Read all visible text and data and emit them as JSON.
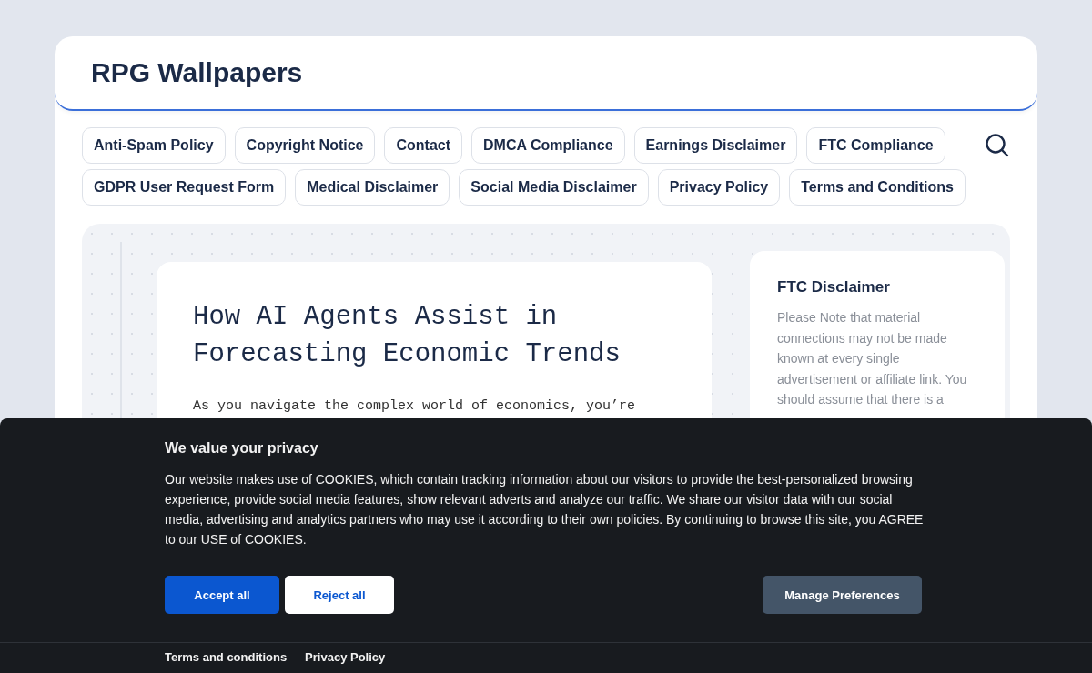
{
  "site": {
    "title": "RPG Wallpapers"
  },
  "nav": {
    "items": [
      {
        "label": "Anti-Spam Policy"
      },
      {
        "label": "Copyright Notice"
      },
      {
        "label": "Contact"
      },
      {
        "label": "DMCA Compliance"
      },
      {
        "label": "Earnings Disclaimer"
      },
      {
        "label": "FTC Compliance"
      },
      {
        "label": "GDPR User Request Form"
      },
      {
        "label": "Medical Disclaimer"
      },
      {
        "label": "Social Media Disclaimer"
      },
      {
        "label": "Privacy Policy"
      },
      {
        "label": "Terms and Conditions"
      }
    ]
  },
  "article": {
    "title": "How AI Agents Assist in Forecasting Economic Trends",
    "excerpt": "As you navigate the complex world of economics, you’re"
  },
  "sidebar": {
    "title": "FTC Disclaimer",
    "text": "Please Note that material connections may not be made known at every single advertisement or affiliate link. You should assume that there is a"
  },
  "cookie_banner": {
    "title": "We value your privacy",
    "text": "Our website makes use of COOKIES, which contain tracking information about our visitors to provide the best-personalized browsing experience, provide social media features, show relevant adverts and analyze our traffic. We share our visitor data with our social media, advertising and analytics partners who may use it according to their own policies. By continuing to browse this site, you AGREE to our USE of COOKIES.",
    "buttons": [
      {
        "label": "Accept all",
        "kind": "primary"
      },
      {
        "label": "Reject all",
        "kind": "secondary"
      },
      {
        "label": "Manage Preferences",
        "kind": "muted"
      }
    ],
    "links": [
      {
        "label": "Terms and conditions"
      },
      {
        "label": "Privacy Policy"
      }
    ]
  }
}
